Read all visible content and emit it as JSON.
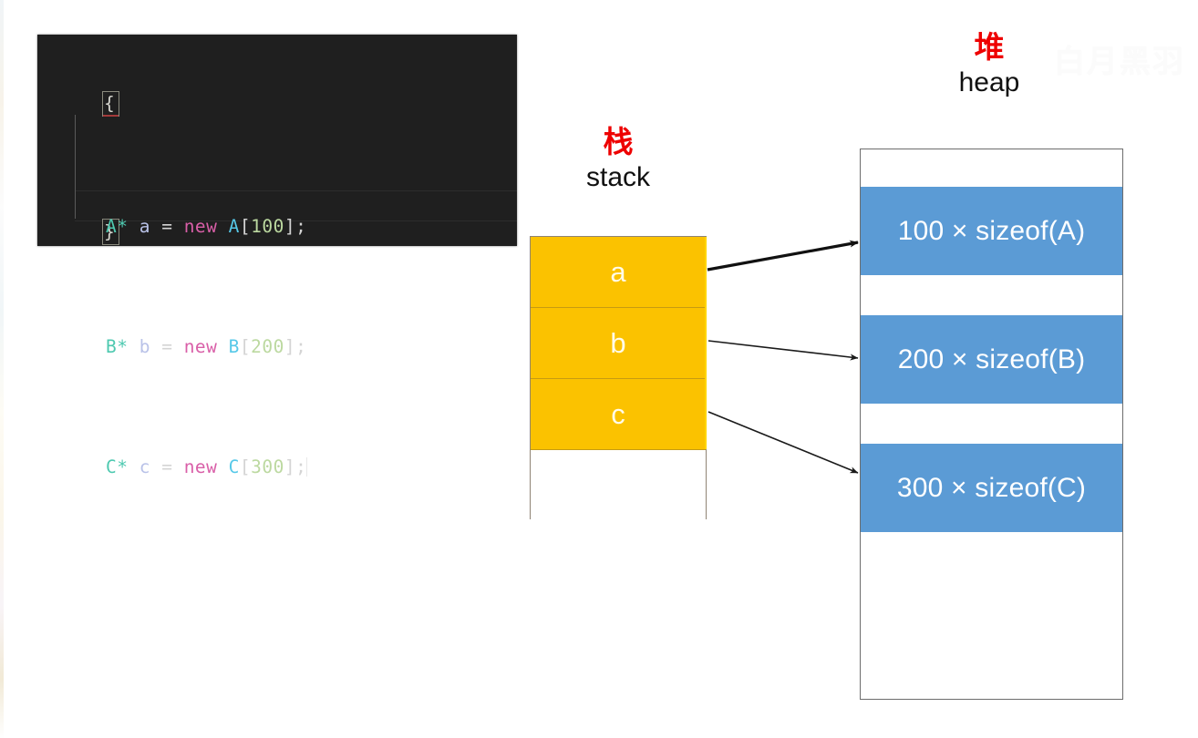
{
  "diagram": {
    "title_watermark": "白月黑羽",
    "stack": {
      "label_cn": "栈",
      "label_en": "stack",
      "cells": [
        {
          "label": "a"
        },
        {
          "label": "b"
        },
        {
          "label": "c"
        },
        {
          "label": ""
        }
      ],
      "fill_color": "#FBC200",
      "text_color": "#FFFBE8",
      "border_color": "#8F8475"
    },
    "heap": {
      "label_cn": "堆",
      "label_en": "heap",
      "blocks": [
        {
          "label": "100 × sizeof(A)"
        },
        {
          "label": "200 × sizeof(B)"
        },
        {
          "label": "300 × sizeof(C)"
        }
      ],
      "fill_color": "#5B9BD5",
      "text_color": "#FFFFFF",
      "border_color": "#6D6D6D"
    },
    "arrows": [
      {
        "from": "a",
        "to": "100 × sizeof(A)"
      },
      {
        "from": "b",
        "to": "200 × sizeof(B)"
      },
      {
        "from": "c",
        "to": "300 × sizeof(C)"
      }
    ]
  },
  "code": {
    "open_brace": "{",
    "close_brace": "}",
    "lines": [
      {
        "indent": "    ",
        "type": "A*",
        "space1": " ",
        "var": "a",
        "eq": " = ",
        "kw": "new",
        "space2": " ",
        "cls": "A",
        "lb": "[",
        "num": "100",
        "rb": "]",
        "semi": ";"
      },
      {
        "indent": "    ",
        "type": "B*",
        "space1": " ",
        "var": "b",
        "eq": " = ",
        "kw": "new",
        "space2": " ",
        "cls": "B",
        "lb": "[",
        "num": "200",
        "rb": "]",
        "semi": ";"
      },
      {
        "indent": "    ",
        "type": "C*",
        "space1": " ",
        "var": "c",
        "eq": " = ",
        "kw": "new",
        "space2": " ",
        "cls": "C",
        "lb": "[",
        "num": "300",
        "rb": "]",
        "semi": ";"
      }
    ],
    "background": "#1F1F1F",
    "colors": {
      "type": "#4EC9B0",
      "variable": "#B9C2E8",
      "keyword": "#D95FA8",
      "class": "#56C8E8",
      "number": "#BCD9A0",
      "punctuation": "#D4D4D4"
    }
  }
}
